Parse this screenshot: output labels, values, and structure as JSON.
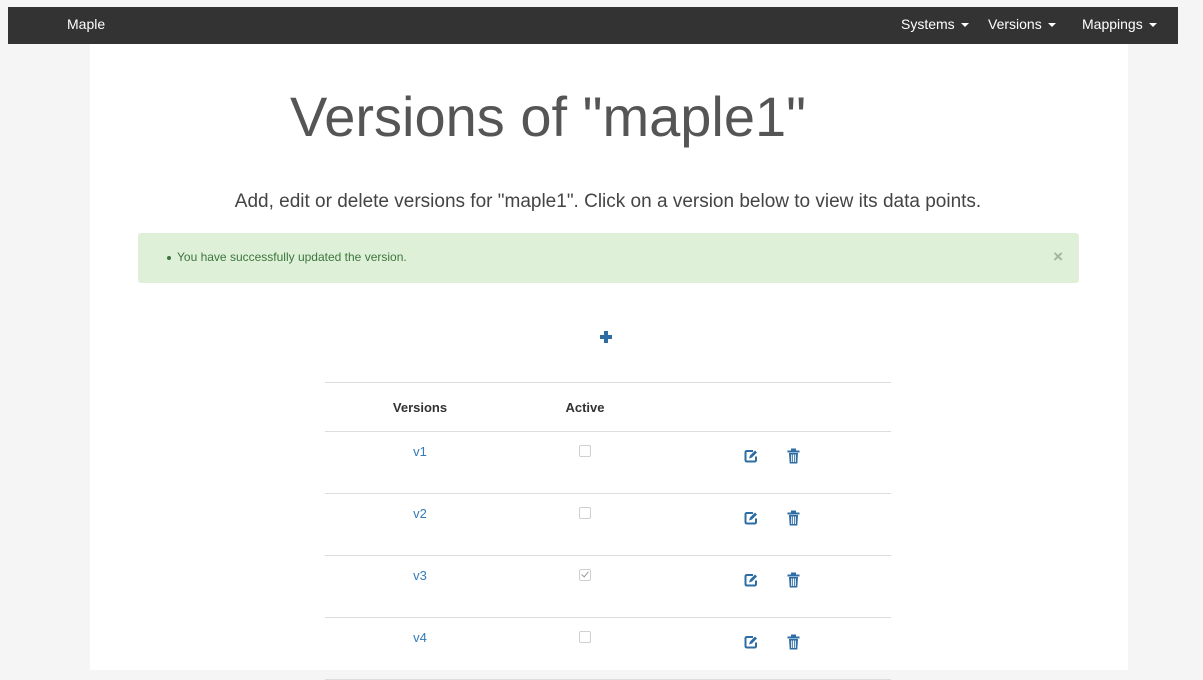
{
  "navbar": {
    "brand": "Maple",
    "items": [
      {
        "label": "Systems"
      },
      {
        "label": "Versions"
      },
      {
        "label": "Mappings"
      }
    ]
  },
  "page": {
    "title": "Versions of \"maple1\"",
    "subtitle": "Add, edit or delete versions for \"maple1\". Click on a version below to view its data points."
  },
  "alert": {
    "message": "You have successfully updated the version.",
    "close": "×"
  },
  "table": {
    "headers": {
      "version": "Versions",
      "active": "Active"
    },
    "rows": [
      {
        "version": "v1",
        "active": false
      },
      {
        "version": "v2",
        "active": false
      },
      {
        "version": "v3",
        "active": true
      },
      {
        "version": "v4",
        "active": false
      }
    ]
  },
  "colors": {
    "navbar": "#333333",
    "link": "#337ab7",
    "icon": "#2e6da4",
    "alert_bg": "#dff0d8",
    "alert_text": "#3c763d"
  },
  "icons": {
    "add": "plus-icon",
    "edit": "edit-icon",
    "delete": "trash-icon"
  }
}
